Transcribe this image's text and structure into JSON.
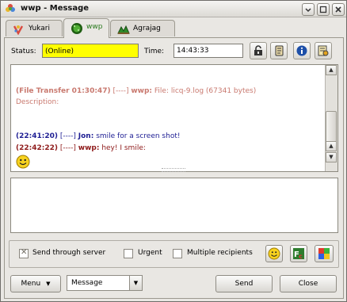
{
  "window": {
    "title": "wwp - Message",
    "controls": [
      "minimize",
      "maximize",
      "close"
    ]
  },
  "tabs": [
    {
      "label": "Yukari",
      "icon": "licq-flower-icon",
      "active": false
    },
    {
      "label": "wwp",
      "icon": "online-status-icon",
      "active": true
    },
    {
      "label": "Agrajag",
      "icon": "away-status-icon",
      "active": false
    }
  ],
  "toolbar": {
    "status_label": "Status:",
    "status_value": "(Online)",
    "time_label": "Time:",
    "time_value": "14:43:33",
    "buttons": [
      "secure-channel-icon",
      "history-icon",
      "user-info-icon",
      "encoding-icon"
    ]
  },
  "history": {
    "entries": [
      {
        "stamp": "(File Transfer 01:30:47)",
        "dir": "[----]",
        "nick": "wwp:",
        "text": "File: licq-9.log (67341 bytes)",
        "color": "pink"
      },
      {
        "stamp": "",
        "dir": "",
        "nick": "",
        "text": "Description:",
        "color": "pink"
      },
      {
        "stamp": "(22:41:20)",
        "dir": "[----]",
        "nick": "Jon:",
        "text": "smile for a screen shot!",
        "color": "blue"
      },
      {
        "stamp": "(22:42:22)",
        "dir": "[----]",
        "nick": "wwp:",
        "text": "hey! I smile:",
        "color": "red"
      }
    ],
    "emoticon": "smiley-face-icon"
  },
  "compose": {
    "value": ""
  },
  "options": {
    "send_through_server": {
      "label": "Send through server",
      "checked": true
    },
    "urgent": {
      "label": "Urgent",
      "checked": false
    },
    "multiple_recipients": {
      "label": "Multiple recipients",
      "checked": false
    },
    "buttons": [
      "smiley-icon",
      "text-color-icon",
      "background-color-icon"
    ]
  },
  "footer": {
    "menu_label": "Menu",
    "event_type": "Message",
    "send_label": "Send",
    "close_label": "Close"
  },
  "colors": {
    "status_bg": "#ffff00",
    "pink": "#c9796f",
    "blue": "#1d1d93",
    "red": "#8e1a1a",
    "active_tab": "#2a7a1e"
  }
}
